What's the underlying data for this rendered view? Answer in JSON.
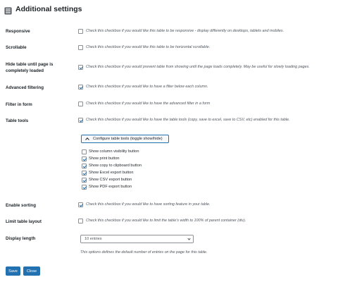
{
  "header": {
    "title": "Additional settings",
    "icon": "settings-panel-icon"
  },
  "rows": [
    {
      "label": "Responsive",
      "checked": false,
      "description": "Check this checkbox if you would like this table to be responsive - display differently on desktops, tablets and mobiles."
    },
    {
      "label": "Scrollable",
      "checked": false,
      "description": "Check this checkbox if you would like this table to be horizontal scrollable."
    },
    {
      "label": "Hide table until page is completely loaded",
      "checked": true,
      "description": "Check this checkbox if you would prevent table from showing until the page loads completely. May be useful for slowly loading pages."
    },
    {
      "label": "Advanced filtering",
      "checked": true,
      "description": "Check this checkbox if you would like to have a filter below each column."
    },
    {
      "label": "Filter in form",
      "checked": false,
      "description": "Check this checkbox if you would like to have the advanced filter in a form"
    },
    {
      "label": "Table tools",
      "checked": true,
      "description": "Check this checkbox if you would like to have the table tools (copy, save to excel, save to CSV, etc) enabled for this table."
    }
  ],
  "table_tools": {
    "toggle_label": "Configure table tools (toggle show/hide)",
    "options": [
      {
        "label": "Show column visibility button",
        "checked": false
      },
      {
        "label": "Show print button",
        "checked": true
      },
      {
        "label": "Show copy to clipboard button",
        "checked": true
      },
      {
        "label": "Show Excel export button",
        "checked": true
      },
      {
        "label": "Show CSV export button",
        "checked": true
      },
      {
        "label": "Show PDF export button",
        "checked": true
      }
    ]
  },
  "rows2": [
    {
      "label": "Enable sorting",
      "checked": true,
      "description": "Check this checkbox if you would like to have sorting feature in your table."
    },
    {
      "label": "Limit table layout",
      "checked": false,
      "description": "Check this checkbox if you would like to limit the table's width to 100% of parent container (div)."
    }
  ],
  "display_length": {
    "label": "Display length",
    "selected": "10 entries",
    "description": "This options defines the default number of entries on the page for this table."
  },
  "buttons": {
    "save": "Save",
    "close": "Close"
  },
  "colors": {
    "accent": "#2271b1",
    "text": "#1d2327",
    "muted": "#50575e",
    "border": "#8c8f94"
  }
}
